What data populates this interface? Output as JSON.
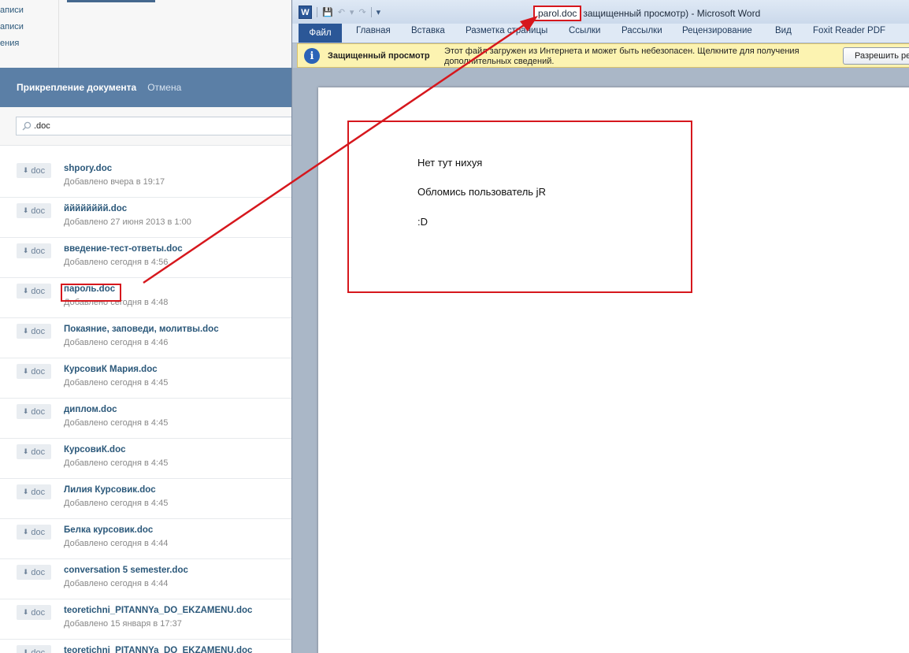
{
  "background": {
    "sidebar_fragments": [
      "аписи",
      "аписи",
      "ения"
    ]
  },
  "attach_dialog": {
    "title": "Прикрепление документа",
    "cancel": "Отмена",
    "search_value": ".doc",
    "badge_label": "doc",
    "documents": [
      {
        "name": "shpory.doc",
        "date": "Добавлено вчера в 19:17"
      },
      {
        "name": "йййййййй.doc",
        "date": "Добавлено 27 июня 2013 в 1:00"
      },
      {
        "name": "введение-тест-ответы.doc",
        "date": "Добавлено сегодня в 4:56"
      },
      {
        "name": "пароль.doc",
        "date": "Добавлено сегодня в 4:48"
      },
      {
        "name": "Покаяние, заповеди, молитвы.doc",
        "date": "Добавлено сегодня в 4:46"
      },
      {
        "name": "КурсовиК Мария.doc",
        "date": "Добавлено сегодня в 4:45"
      },
      {
        "name": "диплом.doc",
        "date": "Добавлено сегодня в 4:45"
      },
      {
        "name": "КурсовиК.doc",
        "date": "Добавлено сегодня в 4:45"
      },
      {
        "name": "Лилия Курсовик.doc",
        "date": "Добавлено сегодня в 4:45"
      },
      {
        "name": "Белка курсовик.doc",
        "date": "Добавлено сегодня в 4:44"
      },
      {
        "name": "conversation 5 semester.doc",
        "date": "Добавлено сегодня в 4:44"
      },
      {
        "name": "teoretichni_PITANNYa_DO_EKZAMENU.doc",
        "date": "Добавлено 15 января в 17:37"
      },
      {
        "name": "teoretichni_PITANNYa_DO_EKZAMENU.doc",
        "date": ""
      }
    ]
  },
  "word": {
    "app_icon": "W",
    "filename": "parol.doc",
    "title_rest": "защищенный просмотр)  -  Microsoft Word",
    "tabs": [
      "Файл",
      "Главная",
      "Вставка",
      "Разметка страницы",
      "Ссылки",
      "Рассылки",
      "Рецензирование",
      "Вид",
      "Foxit Reader PDF"
    ],
    "message_bar": {
      "title": "Защищенный просмотр",
      "text": "Этот файл загружен из Интернета и может быть небезопасен. Щелкните для получения дополнительных сведений.",
      "button": "Разрешить ре"
    },
    "document_lines": [
      "Нет тут нихуя",
      "Обломись пользователь  jR",
      ":D"
    ]
  },
  "colors": {
    "vk_header": "#5b7fa6",
    "vk_link": "#2b587a",
    "annotation_red": "#d6171d",
    "word_blue": "#2b5797",
    "message_bar": "#fcf3b1"
  }
}
